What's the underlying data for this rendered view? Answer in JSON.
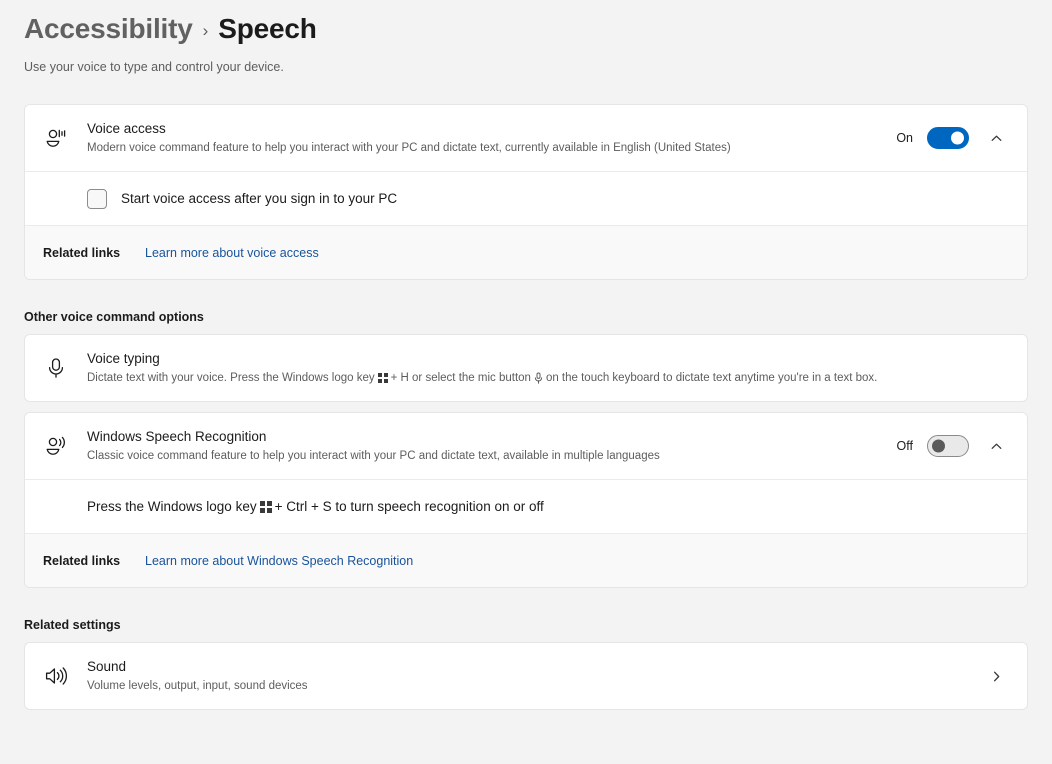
{
  "header": {
    "breadcrumb_parent": "Accessibility",
    "breadcrumb_separator": "›",
    "breadcrumb_current": "Speech",
    "subtitle": "Use your voice to type and control your device."
  },
  "voice_access": {
    "icon": "voice-access-icon",
    "title": "Voice access",
    "description": "Modern voice command feature to help you interact with your PC and dictate text, currently available in English (United States)",
    "state_label": "On",
    "toggle_state": "on",
    "expand_icon": "chevron-up-icon",
    "checkbox": {
      "label": "Start voice access after you sign in to your PC",
      "checked": false
    },
    "related_links": {
      "label": "Related links",
      "link_text": "Learn more about voice access"
    }
  },
  "other_options": {
    "section_title": "Other voice command options",
    "voice_typing": {
      "icon": "microphone-icon",
      "title": "Voice typing",
      "desc_part1": "Dictate text with your voice. Press the Windows logo key",
      "desc_part2": "+ H or select the mic button",
      "desc_part3": "on the touch keyboard to dictate text anytime you're in a text box."
    },
    "speech_recognition": {
      "icon": "voice-access-icon",
      "title": "Windows Speech Recognition",
      "description": "Classic voice command feature to help you interact with your PC and dictate text, available in multiple languages",
      "state_label": "Off",
      "toggle_state": "off",
      "expand_icon": "chevron-up-icon",
      "shortcut_part1": "Press the Windows logo key",
      "shortcut_part2": "+ Ctrl + S to turn speech recognition on or off",
      "related_links": {
        "label": "Related links",
        "link_text": "Learn more about Windows Speech Recognition"
      }
    }
  },
  "related_settings": {
    "section_title": "Related settings",
    "sound": {
      "icon": "speaker-icon",
      "title": "Sound",
      "description": "Volume levels, output, input, sound devices",
      "chevron": "chevron-right-icon"
    }
  },
  "colors": {
    "page_background": "#f3f3f3",
    "card_background": "#ffffff",
    "accent_blue": "#0067c0",
    "link_blue": "#19539b",
    "text_primary": "#1b1b1b",
    "text_secondary": "#5d5d5d"
  }
}
